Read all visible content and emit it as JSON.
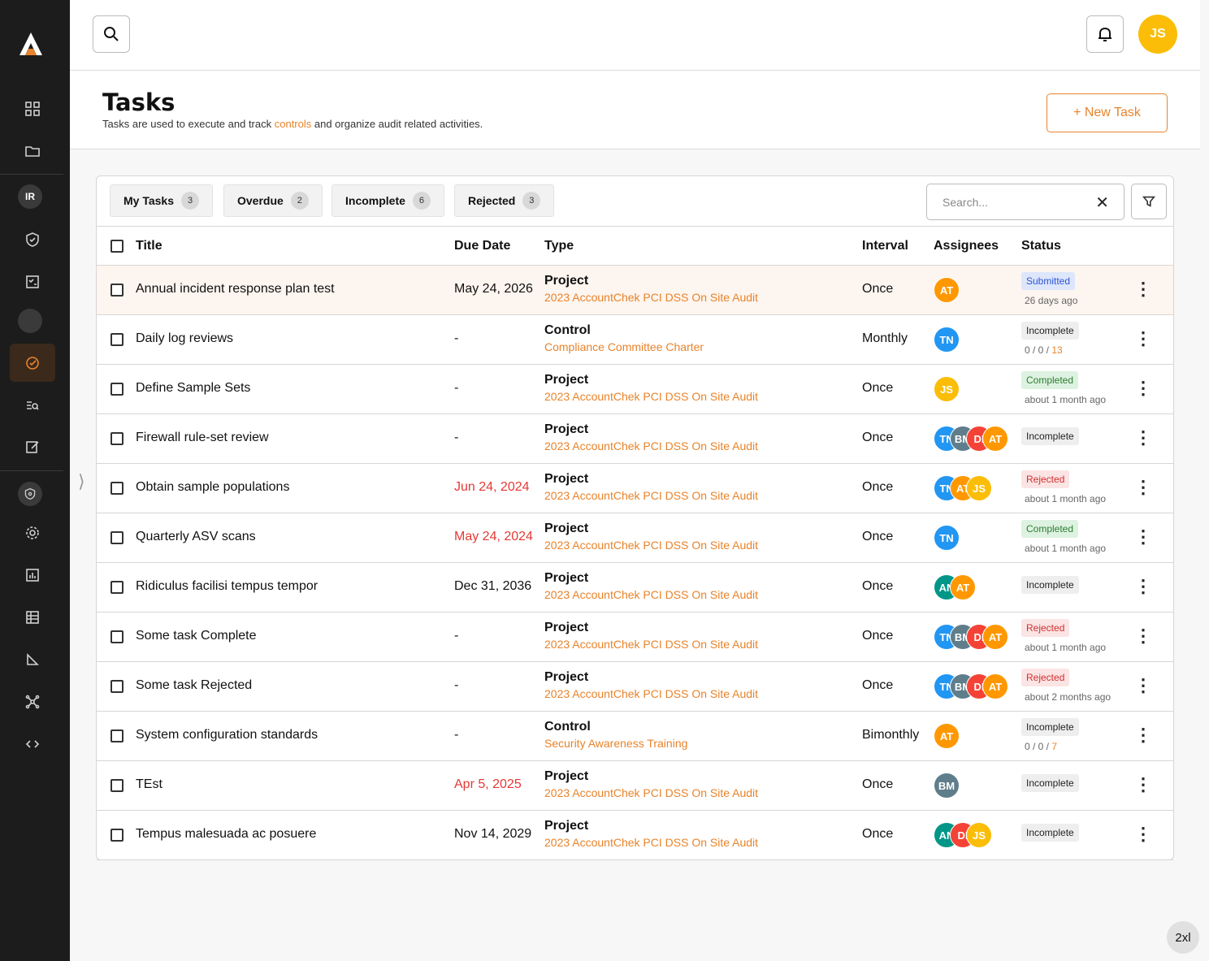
{
  "sidebar": {
    "logo": "A",
    "items": [
      "dashboard-icon",
      "folder-icon",
      "IR",
      "shield-check-icon",
      "checklist-icon",
      "blank-circle",
      "tasks-icon",
      "search-list-icon",
      "edit-icon",
      "shield-badge-icon",
      "gear-icon",
      "report-icon",
      "building-icon",
      "ruler-icon",
      "network-icon",
      "code-icon"
    ]
  },
  "topbar": {
    "user_initials": "JS"
  },
  "header": {
    "title": "Tasks",
    "desc_prefix": "Tasks are used to execute and track ",
    "desc_link": "controls",
    "desc_suffix": " and organize audit related activities.",
    "new_task": "+ New Task"
  },
  "tabs": [
    {
      "label": "My Tasks",
      "count": "3"
    },
    {
      "label": "Overdue",
      "count": "2"
    },
    {
      "label": "Incomplete",
      "count": "6"
    },
    {
      "label": "Rejected",
      "count": "3"
    }
  ],
  "search": {
    "placeholder": "Search..."
  },
  "columns": {
    "title": "Title",
    "due": "Due Date",
    "type": "Type",
    "interval": "Interval",
    "assignees": "Assignees",
    "status": "Status"
  },
  "colors": {
    "accent": "#e8832a",
    "overdue": "#e53935"
  },
  "rows": [
    {
      "title": "Annual incident response plan test",
      "due": "May 24, 2026",
      "overdue": false,
      "type": "Project",
      "link": "2023 AccountChek PCI DSS On Site Audit",
      "interval": "Once",
      "assignees": [
        {
          "i": "AT",
          "c": "#ff9800"
        }
      ],
      "status": "Submitted",
      "sub": "26 days ago",
      "highlight": true
    },
    {
      "title": "Daily log reviews",
      "due": "-",
      "overdue": false,
      "type": "Control",
      "link": "Compliance Committee Charter",
      "interval": "Monthly",
      "assignees": [
        {
          "i": "TN",
          "c": "#2196f3"
        }
      ],
      "status": "Incomplete",
      "sub_a": "0 / 0 / ",
      "sub_b": "13"
    },
    {
      "title": "Define Sample Sets",
      "due": "-",
      "overdue": false,
      "type": "Project",
      "link": "2023 AccountChek PCI DSS On Site Audit",
      "interval": "Once",
      "assignees": [
        {
          "i": "JS",
          "c": "#fbbd08"
        }
      ],
      "status": "Completed",
      "sub": "about 1 month ago"
    },
    {
      "title": "Firewall rule-set review",
      "due": "-",
      "overdue": false,
      "type": "Project",
      "link": "2023 AccountChek PCI DSS On Site Audit",
      "interval": "Once",
      "assignees": [
        {
          "i": "TN",
          "c": "#2196f3"
        },
        {
          "i": "BM",
          "c": "#607d8b"
        },
        {
          "i": "DI",
          "c": "#f44336"
        },
        {
          "i": "AT",
          "c": "#ff9800"
        }
      ],
      "status": "Incomplete"
    },
    {
      "title": "Obtain sample populations",
      "due": "Jun 24, 2024",
      "overdue": true,
      "type": "Project",
      "link": "2023 AccountChek PCI DSS On Site Audit",
      "interval": "Once",
      "assignees": [
        {
          "i": "TN",
          "c": "#2196f3"
        },
        {
          "i": "AT",
          "c": "#ff9800"
        },
        {
          "i": "JS",
          "c": "#fbbd08"
        }
      ],
      "status": "Rejected",
      "sub": "about 1 month ago"
    },
    {
      "title": "Quarterly ASV scans",
      "due": "May 24, 2024",
      "overdue": true,
      "type": "Project",
      "link": "2023 AccountChek PCI DSS On Site Audit",
      "interval": "Once",
      "assignees": [
        {
          "i": "TN",
          "c": "#2196f3"
        }
      ],
      "status": "Completed",
      "sub": "about 1 month ago"
    },
    {
      "title": "Ridiculus facilisi tempus tempor",
      "due": "Dec 31, 2036",
      "overdue": false,
      "type": "Project",
      "link": "2023 AccountChek PCI DSS On Site Audit",
      "interval": "Once",
      "assignees": [
        {
          "i": "AN",
          "c": "#009688"
        },
        {
          "i": "AT",
          "c": "#ff9800"
        }
      ],
      "status": "Incomplete"
    },
    {
      "title": "Some task Complete",
      "due": "-",
      "overdue": false,
      "type": "Project",
      "link": "2023 AccountChek PCI DSS On Site Audit",
      "interval": "Once",
      "assignees": [
        {
          "i": "TN",
          "c": "#2196f3"
        },
        {
          "i": "BM",
          "c": "#607d8b"
        },
        {
          "i": "DI",
          "c": "#f44336"
        },
        {
          "i": "AT",
          "c": "#ff9800"
        }
      ],
      "status": "Rejected",
      "sub": "about 1 month ago"
    },
    {
      "title": "Some task Rejected",
      "due": "-",
      "overdue": false,
      "type": "Project",
      "link": "2023 AccountChek PCI DSS On Site Audit",
      "interval": "Once",
      "assignees": [
        {
          "i": "TN",
          "c": "#2196f3"
        },
        {
          "i": "BM",
          "c": "#607d8b"
        },
        {
          "i": "DI",
          "c": "#f44336"
        },
        {
          "i": "AT",
          "c": "#ff9800"
        }
      ],
      "status": "Rejected",
      "sub": "about 2 months ago"
    },
    {
      "title": "System configuration standards",
      "due": "-",
      "overdue": false,
      "type": "Control",
      "link": "Security Awareness Training",
      "interval": "Bimonthly",
      "assignees": [
        {
          "i": "AT",
          "c": "#ff9800"
        }
      ],
      "status": "Incomplete",
      "sub_a": "0 / 0 / ",
      "sub_b": "7"
    },
    {
      "title": "TEst",
      "due": "Apr 5, 2025",
      "overdue": true,
      "type": "Project",
      "link": "2023 AccountChek PCI DSS On Site Audit",
      "interval": "Once",
      "assignees": [
        {
          "i": "BM",
          "c": "#607d8b"
        }
      ],
      "status": "Incomplete"
    },
    {
      "title": "Tempus malesuada ac posuere",
      "due": "Nov 14, 2029",
      "overdue": false,
      "type": "Project",
      "link": "2023 AccountChek PCI DSS On Site Audit",
      "interval": "Once",
      "assignees": [
        {
          "i": "AN",
          "c": "#009688"
        },
        {
          "i": "DI",
          "c": "#f44336"
        },
        {
          "i": "JS",
          "c": "#fbbd08"
        }
      ],
      "status": "Incomplete"
    }
  ],
  "size_indicator": "2xl"
}
